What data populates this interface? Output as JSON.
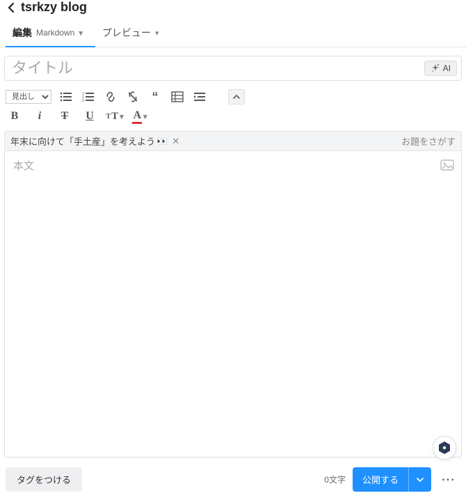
{
  "header": {
    "blog_title": "tsrkzy blog"
  },
  "tabs": {
    "edit": {
      "label": "編集",
      "sublabel": "Markdown"
    },
    "preview": {
      "label": "プレビュー"
    }
  },
  "title": {
    "placeholder": "タイトル",
    "value": "",
    "ai_label": "AI"
  },
  "toolbar": {
    "heading_label": "見出し"
  },
  "prompt": {
    "text": "年末に向けて「手土産」を考えよう",
    "emoji": "👀",
    "search_label": "お題をさがす"
  },
  "body": {
    "placeholder": "本文"
  },
  "footer": {
    "tag_label": "タグをつける",
    "char_count": "0文字",
    "publish_label": "公開する"
  }
}
